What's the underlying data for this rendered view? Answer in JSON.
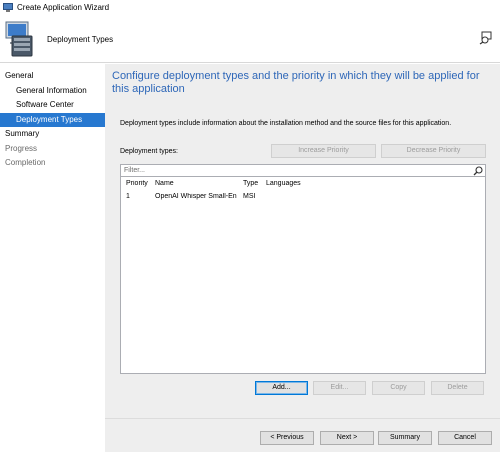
{
  "window": {
    "title": "Create Application Wizard"
  },
  "header": {
    "title": "Deployment Types"
  },
  "sidebar": {
    "items": [
      {
        "label": "General",
        "level": 0,
        "state": "normal"
      },
      {
        "label": "General Information",
        "level": 1,
        "state": "normal"
      },
      {
        "label": "Software Center",
        "level": 1,
        "state": "normal"
      },
      {
        "label": "Deployment Types",
        "level": 1,
        "state": "selected"
      },
      {
        "label": "Summary",
        "level": 0,
        "state": "normal"
      },
      {
        "label": "Progress",
        "level": 0,
        "state": "dim"
      },
      {
        "label": "Completion",
        "level": 0,
        "state": "dim"
      }
    ]
  },
  "main": {
    "heading": "Configure deployment types and the priority in which they will be applied for this application",
    "description": "Deployment types include information about the installation method and the source files for this application.",
    "deployment_types_label": "Deployment types:",
    "increase_priority": "Increase Priority",
    "decrease_priority": "Decrease Priority",
    "filter_placeholder": "Filter...",
    "columns": [
      "Priority",
      "Name",
      "Type",
      "Languages"
    ],
    "rows": [
      {
        "priority": "1",
        "name": "OpenAI Whisper Small-En",
        "type": "MSI",
        "languages": ""
      }
    ],
    "add": "Add...",
    "edit": "Edit...",
    "copy": "Copy",
    "delete": "Delete"
  },
  "footer": {
    "previous": "< Previous",
    "next": "Next >",
    "summary": "Summary",
    "cancel": "Cancel"
  },
  "colors": {
    "accent": "#2778d0",
    "heading": "#2e67b8",
    "content_bg": "#eeeeee"
  }
}
